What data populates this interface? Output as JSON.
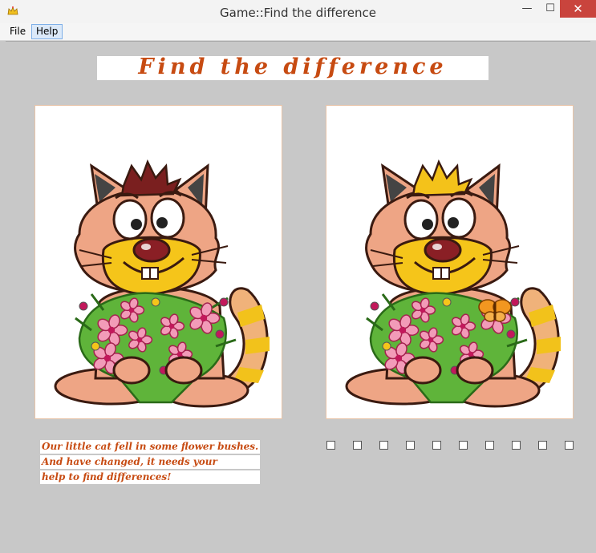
{
  "window": {
    "title": "Game::Find the difference",
    "controls": {
      "minimize": "—",
      "maximize": "☐",
      "close": "✕"
    },
    "icon": "crown-icon"
  },
  "menu": {
    "file": "File",
    "help": "Help"
  },
  "heading": "Find the difference",
  "story": [
    "Our little cat fell in some flower bushes.",
    "And have changed, it needs your",
    "help to find differences!"
  ],
  "pictures": {
    "left": {
      "subject": "cat-with-flower-bouquet",
      "hair_color": "#7a1f1f"
    },
    "right": {
      "subject": "cat-with-flower-bouquet",
      "hair_color": "#f4c21a",
      "extra": "butterfly"
    }
  },
  "differences": {
    "total": 10,
    "found": 0
  },
  "colors": {
    "accent": "#c74b12",
    "background": "#c8c8c8",
    "close_button": "#c9443d"
  }
}
